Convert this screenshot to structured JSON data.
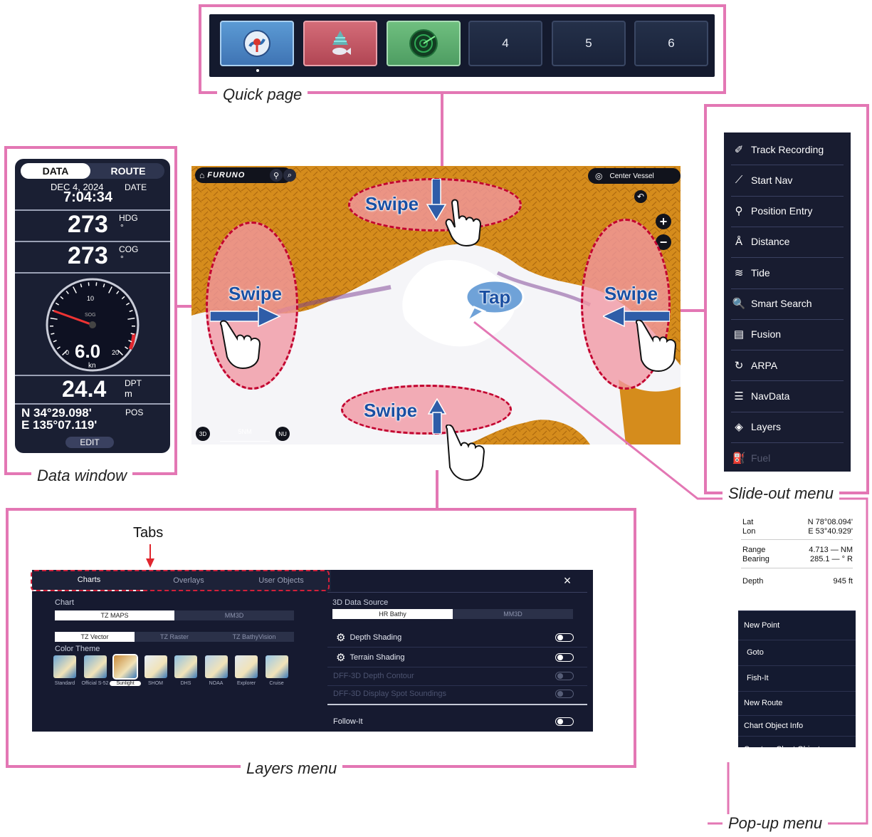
{
  "colors": {
    "frame": "#e377b4",
    "swipe_fill": "#f196a2",
    "swipe_border": "#c2002f",
    "swipe_text": "#1a4fa2"
  },
  "captions": {
    "quick_page": "Quick page",
    "data_window": "Data window",
    "slide_out": "Slide-out menu",
    "layers": "Layers menu",
    "popup": "Pop-up menu",
    "tabs": "Tabs"
  },
  "quick_page": {
    "buttons": [
      {
        "kind": "chart-icon",
        "color": "#4a86c4"
      },
      {
        "kind": "fish-finder-icon",
        "color": "#c0515e"
      },
      {
        "kind": "radar-icon",
        "color": "#5fa96f"
      },
      {
        "label": "4"
      },
      {
        "label": "5"
      },
      {
        "label": "6"
      }
    ]
  },
  "data_window": {
    "tabs": [
      "DATA",
      "ROUTE"
    ],
    "date": "DEC 4, 2024",
    "time": "7:04:34",
    "date_label": "DATE",
    "hdg": {
      "value": "273",
      "label": "HDG",
      "unit": "°"
    },
    "cog": {
      "value": "273",
      "label": "COG",
      "unit": "°"
    },
    "gauge": {
      "sog": "6.0",
      "unit": "kn",
      "label": "SOG",
      "ticks": [
        "0",
        "10",
        "20"
      ],
      "max": 25
    },
    "depth": {
      "value": "24.4",
      "label": "DPT",
      "unit": "m"
    },
    "pos": {
      "lat": "N 34°29.098'",
      "lon": "E 135°07.119'",
      "label": "POS"
    },
    "edit": "EDIT"
  },
  "map": {
    "brand": "FURUNO",
    "center_vessel": "Center Vessel",
    "view_mode": "3D",
    "scale": "5NM",
    "orientation": "NU",
    "swipe": "Swipe",
    "tap": "Tap"
  },
  "slide_out": {
    "items": [
      {
        "label": "Track Recording",
        "icon": "track-recording-icon",
        "glyph": "✐"
      },
      {
        "label": "Start Nav",
        "icon": "start-nav-icon",
        "glyph": "⟋"
      },
      {
        "label": "Position Entry",
        "icon": "position-entry-icon",
        "glyph": "⚲"
      },
      {
        "label": "Distance",
        "icon": "distance-icon",
        "glyph": "Å"
      },
      {
        "label": "Tide",
        "icon": "tide-icon",
        "glyph": "≋"
      },
      {
        "label": "Smart Search",
        "icon": "search-icon",
        "glyph": "🔍"
      },
      {
        "label": "Fusion",
        "icon": "fusion-icon",
        "glyph": "▤"
      },
      {
        "label": "ARPA",
        "icon": "arpa-icon",
        "glyph": "↻"
      },
      {
        "label": "NavData",
        "icon": "navdata-icon",
        "glyph": "☰"
      },
      {
        "label": "Layers",
        "icon": "layers-icon",
        "glyph": "◈"
      },
      {
        "label": "Fuel",
        "icon": "fuel-icon",
        "glyph": "⛽"
      }
    ]
  },
  "layers": {
    "tabs": [
      "Charts",
      "Overlays",
      "User Objects"
    ],
    "close": "×",
    "chart_heading": "Chart",
    "chart_source": [
      "TZ MAPS",
      "MM3D"
    ],
    "chart_type": [
      "TZ Vector",
      "TZ Raster",
      "TZ BathyVision"
    ],
    "color_theme_heading": "Color Theme",
    "themes": [
      "Standard",
      "Official S-52",
      "Sunlight",
      "SHOM",
      "DHS",
      "NOAA",
      "Explorer",
      "Cruise"
    ],
    "data_source_heading": "3D Data Source",
    "data_source": [
      "HR Bathy",
      "MM3D"
    ],
    "options": [
      {
        "label": "Depth Shading",
        "gear": true,
        "enabled": true
      },
      {
        "label": "Terrain Shading",
        "gear": true,
        "enabled": true
      },
      {
        "label": "DFF-3D Depth Contour",
        "gear": false,
        "enabled": false
      },
      {
        "label": "DFF-3D Display Spot Soundings",
        "gear": false,
        "enabled": false
      },
      {
        "label": "Follow-It",
        "gear": false,
        "enabled": true
      }
    ]
  },
  "popup": {
    "lat_label": "Lat",
    "lat": "N 78°08.094'",
    "lon_label": "Lon",
    "lon": "E 53°40.929'",
    "range_label": "Range",
    "range": "4.713 — NM",
    "bearing_label": "Bearing",
    "bearing": "285.1 — ° R",
    "depth_label": "Depth",
    "depth": "945 ft",
    "items": [
      "New Point",
      "Goto",
      "Fish-It",
      "New Route",
      "Chart Object Info",
      "Create a Chart Object"
    ]
  }
}
